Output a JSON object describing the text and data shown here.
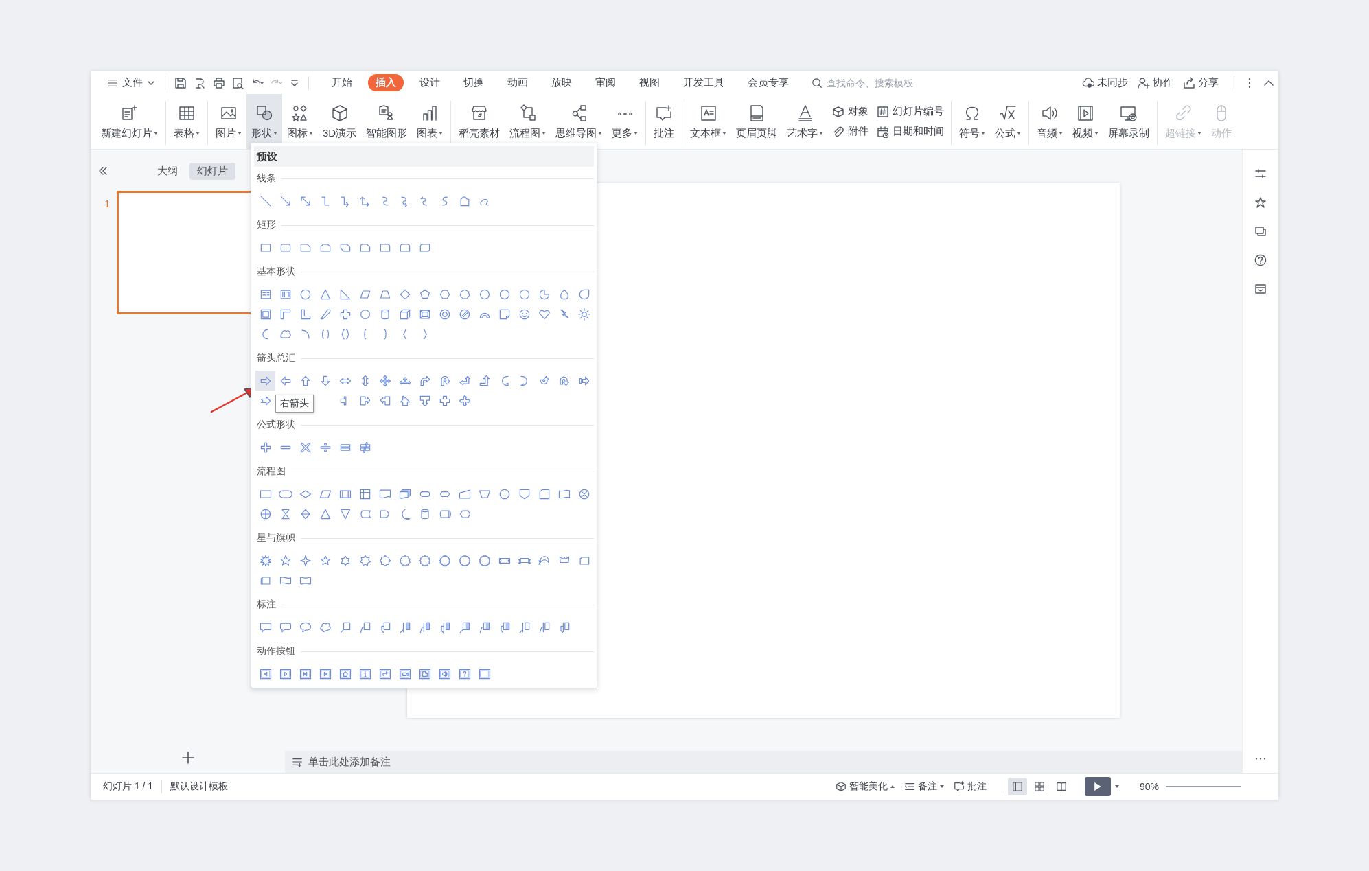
{
  "menu_bar": {
    "file": "文件",
    "tabs": [
      {
        "label": "开始",
        "selected": false
      },
      {
        "label": "插入",
        "selected": true
      },
      {
        "label": "设计",
        "selected": false
      },
      {
        "label": "切换",
        "selected": false
      },
      {
        "label": "动画",
        "selected": false
      },
      {
        "label": "放映",
        "selected": false
      },
      {
        "label": "审阅",
        "selected": false
      },
      {
        "label": "视图",
        "selected": false
      },
      {
        "label": "开发工具",
        "selected": false
      },
      {
        "label": "会员专享",
        "selected": false
      }
    ],
    "search": {
      "placeholder": "查找命令、搜索模板"
    },
    "actions": [
      "未同步",
      "协作",
      "分享"
    ]
  },
  "ribbon": {
    "groups": [
      [
        {
          "kind": "large",
          "label": "新建幻灯片",
          "dropdown": true,
          "selected": false,
          "disabled": false
        }
      ],
      [
        {
          "kind": "large",
          "label": "表格",
          "dropdown": true,
          "selected": false,
          "disabled": false
        }
      ],
      [
        {
          "kind": "large",
          "label": "图片",
          "dropdown": true,
          "selected": false,
          "disabled": false
        },
        {
          "kind": "large",
          "label": "形状",
          "dropdown": true,
          "selected": true,
          "disabled": false
        },
        {
          "kind": "large",
          "label": "图标",
          "dropdown": true,
          "selected": false,
          "disabled": false
        },
        {
          "kind": "large",
          "label": "3D演示",
          "dropdown": false,
          "selected": false,
          "disabled": false
        },
        {
          "kind": "large",
          "label": "智能图形",
          "dropdown": false,
          "selected": false,
          "disabled": false
        },
        {
          "kind": "large",
          "label": "图表",
          "dropdown": true,
          "selected": false,
          "disabled": false
        }
      ],
      [
        {
          "kind": "large",
          "label": "稻壳素材",
          "dropdown": false,
          "selected": false,
          "disabled": false
        },
        {
          "kind": "large",
          "label": "流程图",
          "dropdown": true,
          "selected": false,
          "disabled": false
        },
        {
          "kind": "large",
          "label": "思维导图",
          "dropdown": true,
          "selected": false,
          "disabled": false
        },
        {
          "kind": "large",
          "label": "更多",
          "dropdown": true,
          "selected": false,
          "disabled": false
        }
      ],
      [
        {
          "kind": "large",
          "label": "批注",
          "dropdown": false,
          "selected": false,
          "disabled": false
        }
      ],
      [
        {
          "kind": "large",
          "label": "文本框",
          "dropdown": true,
          "selected": false,
          "disabled": false
        },
        {
          "kind": "large",
          "label": "页眉页脚",
          "dropdown": false,
          "selected": false,
          "disabled": false
        },
        {
          "kind": "large",
          "label": "艺术字",
          "dropdown": true,
          "selected": false,
          "disabled": false
        },
        {
          "kind": "stack",
          "items": [
            {
              "label": "对象"
            },
            {
              "label": "附件"
            }
          ]
        },
        {
          "kind": "stack",
          "items": [
            {
              "label": "幻灯片编号"
            },
            {
              "label": "日期和时间"
            }
          ]
        }
      ],
      [
        {
          "kind": "large",
          "label": "符号",
          "dropdown": true,
          "selected": false,
          "disabled": false
        },
        {
          "kind": "large",
          "label": "公式",
          "dropdown": true,
          "selected": false,
          "disabled": false
        }
      ],
      [
        {
          "kind": "large",
          "label": "音频",
          "dropdown": true,
          "selected": false,
          "disabled": false
        },
        {
          "kind": "large",
          "label": "视频",
          "dropdown": true,
          "selected": false,
          "disabled": false
        },
        {
          "kind": "large",
          "label": "屏幕录制",
          "dropdown": false,
          "selected": false,
          "disabled": false
        }
      ],
      [
        {
          "kind": "large",
          "label": "超链接",
          "dropdown": true,
          "selected": false,
          "disabled": true
        },
        {
          "kind": "large",
          "label": "动作",
          "dropdown": false,
          "selected": false,
          "disabled": true
        }
      ]
    ]
  },
  "left_panel": {
    "tabs": [
      {
        "label": "大纲",
        "selected": false
      },
      {
        "label": "幻灯片",
        "selected": true
      }
    ],
    "slides": [
      {
        "number": "1",
        "selected": true
      }
    ]
  },
  "shape_menu": {
    "title": "预设",
    "sections": [
      {
        "title": "线条",
        "kind": "lines",
        "shapes": [
          {
            "selected": false
          },
          {
            "selected": false
          },
          {
            "selected": false
          },
          {
            "selected": false
          },
          {
            "selected": false
          },
          {
            "selected": false
          },
          {
            "selected": false
          },
          {
            "selected": false
          },
          {
            "selected": false
          },
          {
            "selected": false
          },
          {
            "selected": false
          },
          {
            "selected": false
          }
        ]
      },
      {
        "title": "矩形",
        "kind": "rectangles",
        "shapes": [
          {
            "selected": false
          },
          {
            "selected": false
          },
          {
            "selected": false
          },
          {
            "selected": false
          },
          {
            "selected": false
          },
          {
            "selected": false
          },
          {
            "selected": false
          },
          {
            "selected": false
          },
          {
            "selected": false
          }
        ]
      },
      {
        "title": "基本形状",
        "kind": "basic",
        "shapes": [
          {
            "selected": false
          },
          {
            "selected": false
          },
          {
            "selected": false
          },
          {
            "selected": false
          },
          {
            "selected": false
          },
          {
            "selected": false
          },
          {
            "selected": false
          },
          {
            "selected": false
          },
          {
            "selected": false
          },
          {
            "selected": false
          },
          {
            "selected": false
          },
          {
            "selected": false
          },
          {
            "selected": false
          },
          {
            "selected": false
          },
          {
            "selected": false
          },
          {
            "selected": false
          },
          {
            "selected": false
          },
          {
            "selected": false
          },
          {
            "selected": false
          },
          {
            "selected": false
          },
          {
            "selected": false
          },
          {
            "selected": false
          },
          {
            "selected": false
          },
          {
            "selected": false
          },
          {
            "selected": false
          },
          {
            "selected": false
          },
          {
            "selected": false
          },
          {
            "selected": false
          },
          {
            "selected": false
          },
          {
            "selected": false
          },
          {
            "selected": false
          },
          {
            "selected": false
          },
          {
            "selected": false
          },
          {
            "selected": false
          },
          {
            "selected": false
          },
          {
            "selected": false
          },
          {
            "selected": false
          },
          {
            "selected": false
          },
          {
            "selected": false
          },
          {
            "selected": false
          },
          {
            "selected": false
          },
          {
            "selected": false
          },
          {
            "selected": false
          }
        ]
      },
      {
        "title": "箭头总汇",
        "kind": "arrows",
        "tooltip": "右箭头",
        "shapes": [
          {
            "selected": true
          },
          {
            "selected": false
          },
          {
            "selected": false
          },
          {
            "selected": false
          },
          {
            "selected": false
          },
          {
            "selected": false
          },
          {
            "selected": false
          },
          {
            "selected": false
          },
          {
            "selected": false
          },
          {
            "selected": false
          },
          {
            "selected": false
          },
          {
            "selected": false
          },
          {
            "selected": false
          },
          {
            "selected": false
          },
          {
            "selected": false
          },
          {
            "selected": false
          },
          {
            "selected": false
          },
          {
            "selected": false
          },
          {
            "selected": false
          },
          {
            "selected": false
          },
          {
            "selected": false
          },
          {
            "selected": false
          },
          {
            "selected": false
          },
          {
            "selected": false
          },
          {
            "selected": false
          }
        ]
      },
      {
        "title": "公式形状",
        "kind": "equation",
        "shapes": [
          {
            "selected": false
          },
          {
            "selected": false
          },
          {
            "selected": false
          },
          {
            "selected": false
          },
          {
            "selected": false
          },
          {
            "selected": false
          }
        ]
      },
      {
        "title": "流程图",
        "kind": "flowchart",
        "shapes": [
          {
            "selected": false
          },
          {
            "selected": false
          },
          {
            "selected": false
          },
          {
            "selected": false
          },
          {
            "selected": false
          },
          {
            "selected": false
          },
          {
            "selected": false
          },
          {
            "selected": false
          },
          {
            "selected": false
          },
          {
            "selected": false
          },
          {
            "selected": false
          },
          {
            "selected": false
          },
          {
            "selected": false
          },
          {
            "selected": false
          },
          {
            "selected": false
          },
          {
            "selected": false
          },
          {
            "selected": false
          },
          {
            "selected": false
          },
          {
            "selected": false
          },
          {
            "selected": false
          },
          {
            "selected": false
          },
          {
            "selected": false
          },
          {
            "selected": false
          },
          {
            "selected": false
          },
          {
            "selected": false
          },
          {
            "selected": false
          },
          {
            "selected": false
          },
          {
            "selected": false
          }
        ]
      },
      {
        "title": "星与旗帜",
        "kind": "stars",
        "shapes": [
          {
            "selected": false
          },
          {
            "selected": false
          },
          {
            "selected": false
          },
          {
            "selected": false
          },
          {
            "selected": false
          },
          {
            "selected": false
          },
          {
            "selected": false
          },
          {
            "selected": false
          },
          {
            "selected": false
          },
          {
            "selected": false
          },
          {
            "selected": false
          },
          {
            "selected": false
          },
          {
            "selected": false
          },
          {
            "selected": false
          },
          {
            "selected": false
          },
          {
            "selected": false
          },
          {
            "selected": false
          },
          {
            "selected": false
          },
          {
            "selected": false
          },
          {
            "selected": false
          }
        ]
      },
      {
        "title": "标注",
        "kind": "callouts",
        "shapes": [
          {
            "selected": false
          },
          {
            "selected": false
          },
          {
            "selected": false
          },
          {
            "selected": false
          },
          {
            "selected": false
          },
          {
            "selected": false
          },
          {
            "selected": false
          },
          {
            "selected": false
          },
          {
            "selected": false
          },
          {
            "selected": false
          },
          {
            "selected": false
          },
          {
            "selected": false
          },
          {
            "selected": false
          },
          {
            "selected": false
          },
          {
            "selected": false
          },
          {
            "selected": false
          }
        ]
      },
      {
        "title": "动作按钮",
        "kind": "action_buttons",
        "shapes": [
          {
            "selected": false
          },
          {
            "selected": false
          },
          {
            "selected": false
          },
          {
            "selected": false
          },
          {
            "selected": false
          },
          {
            "selected": false
          },
          {
            "selected": false
          },
          {
            "selected": false
          },
          {
            "selected": false
          },
          {
            "selected": false
          },
          {
            "selected": false
          },
          {
            "selected": false
          }
        ]
      }
    ]
  },
  "notes": {
    "placeholder": "单击此处添加备注"
  },
  "status_bar": {
    "slide_info": "幻灯片 1 / 1",
    "template": "默认设计模板",
    "beautify": "智能美化",
    "notes": "备注",
    "comments": "批注",
    "views": [
      {
        "selected": true
      },
      {
        "selected": false
      },
      {
        "selected": false
      }
    ],
    "zoom": "90%"
  }
}
